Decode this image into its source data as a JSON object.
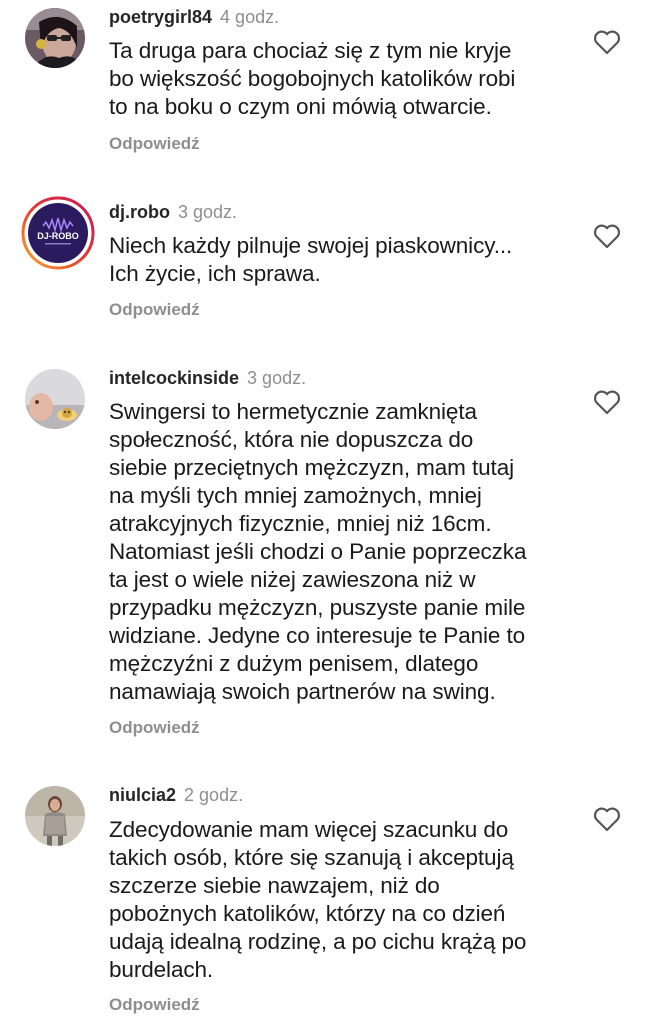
{
  "comments": [
    {
      "username": "poetrygirl84",
      "time": "4 godz.",
      "text": "Ta druga para chociaż się z tym nie kryje\nbo większość bogobojnych katolików robi\nto na boku o czym oni mówią otwarcie.",
      "reply_label": "Odpowiedź",
      "avatar_icon": "user-photo-icon",
      "like_icon": "heart-icon"
    },
    {
      "username": "dj.robo",
      "time": "3 godz.",
      "text": "Niech każdy pilnuje swojej piaskownicy...\nIch życie, ich sprawa.",
      "reply_label": "Odpowiedź",
      "avatar_logo_text": "DJ-ROBO",
      "avatar_icon": "dj-logo-icon",
      "like_icon": "heart-icon"
    },
    {
      "username": "intelcockinside",
      "time": "3 godz.",
      "text": "Swingersi to hermetycznie zamknięta\nspołeczność, która nie dopuszcza do\nsiebie przeciętnych mężczyzn, mam tutaj\nna myśli tych mniej zamożnych, mniej\natrakcyjnych fizycznie, mniej niż 16cm.\nNatomiast jeśli chodzi o Panie poprzeczka\nta jest o wiele niżej zawieszona niż w\nprzypadku mężczyzn, puszyste panie mile\nwidziane. Jedyne co interesuje te Panie to\nmężczyźni z dużym penisem, dlatego\nnamawiają swoich partnerów na swing.",
      "reply_label": "Odpowiedź",
      "avatar_icon": "user-photo-icon",
      "like_icon": "heart-icon"
    },
    {
      "username": "niulcia2",
      "time": "2 godz.",
      "text": "Zdecydowanie mam więcej szacunku do\ntakich osób, które się szanują i akceptują\nszczerze siebie nawzajem, niż do\npobożnych katolików, którzy na co dzień\nudają idealną rodzinę, a po cichu krążą po\nburdelach.",
      "reply_label": "Odpowiedź",
      "avatar_icon": "user-photo-icon",
      "like_icon": "heart-icon"
    }
  ],
  "colors": {
    "username": "#262626",
    "secondary_text": "#8e8e8e",
    "body_text": "#1a1a1a",
    "story_ring_start": "#f9a825",
    "story_ring_end": "#c2185b",
    "dj_logo_bg": "#2a1a5e"
  }
}
